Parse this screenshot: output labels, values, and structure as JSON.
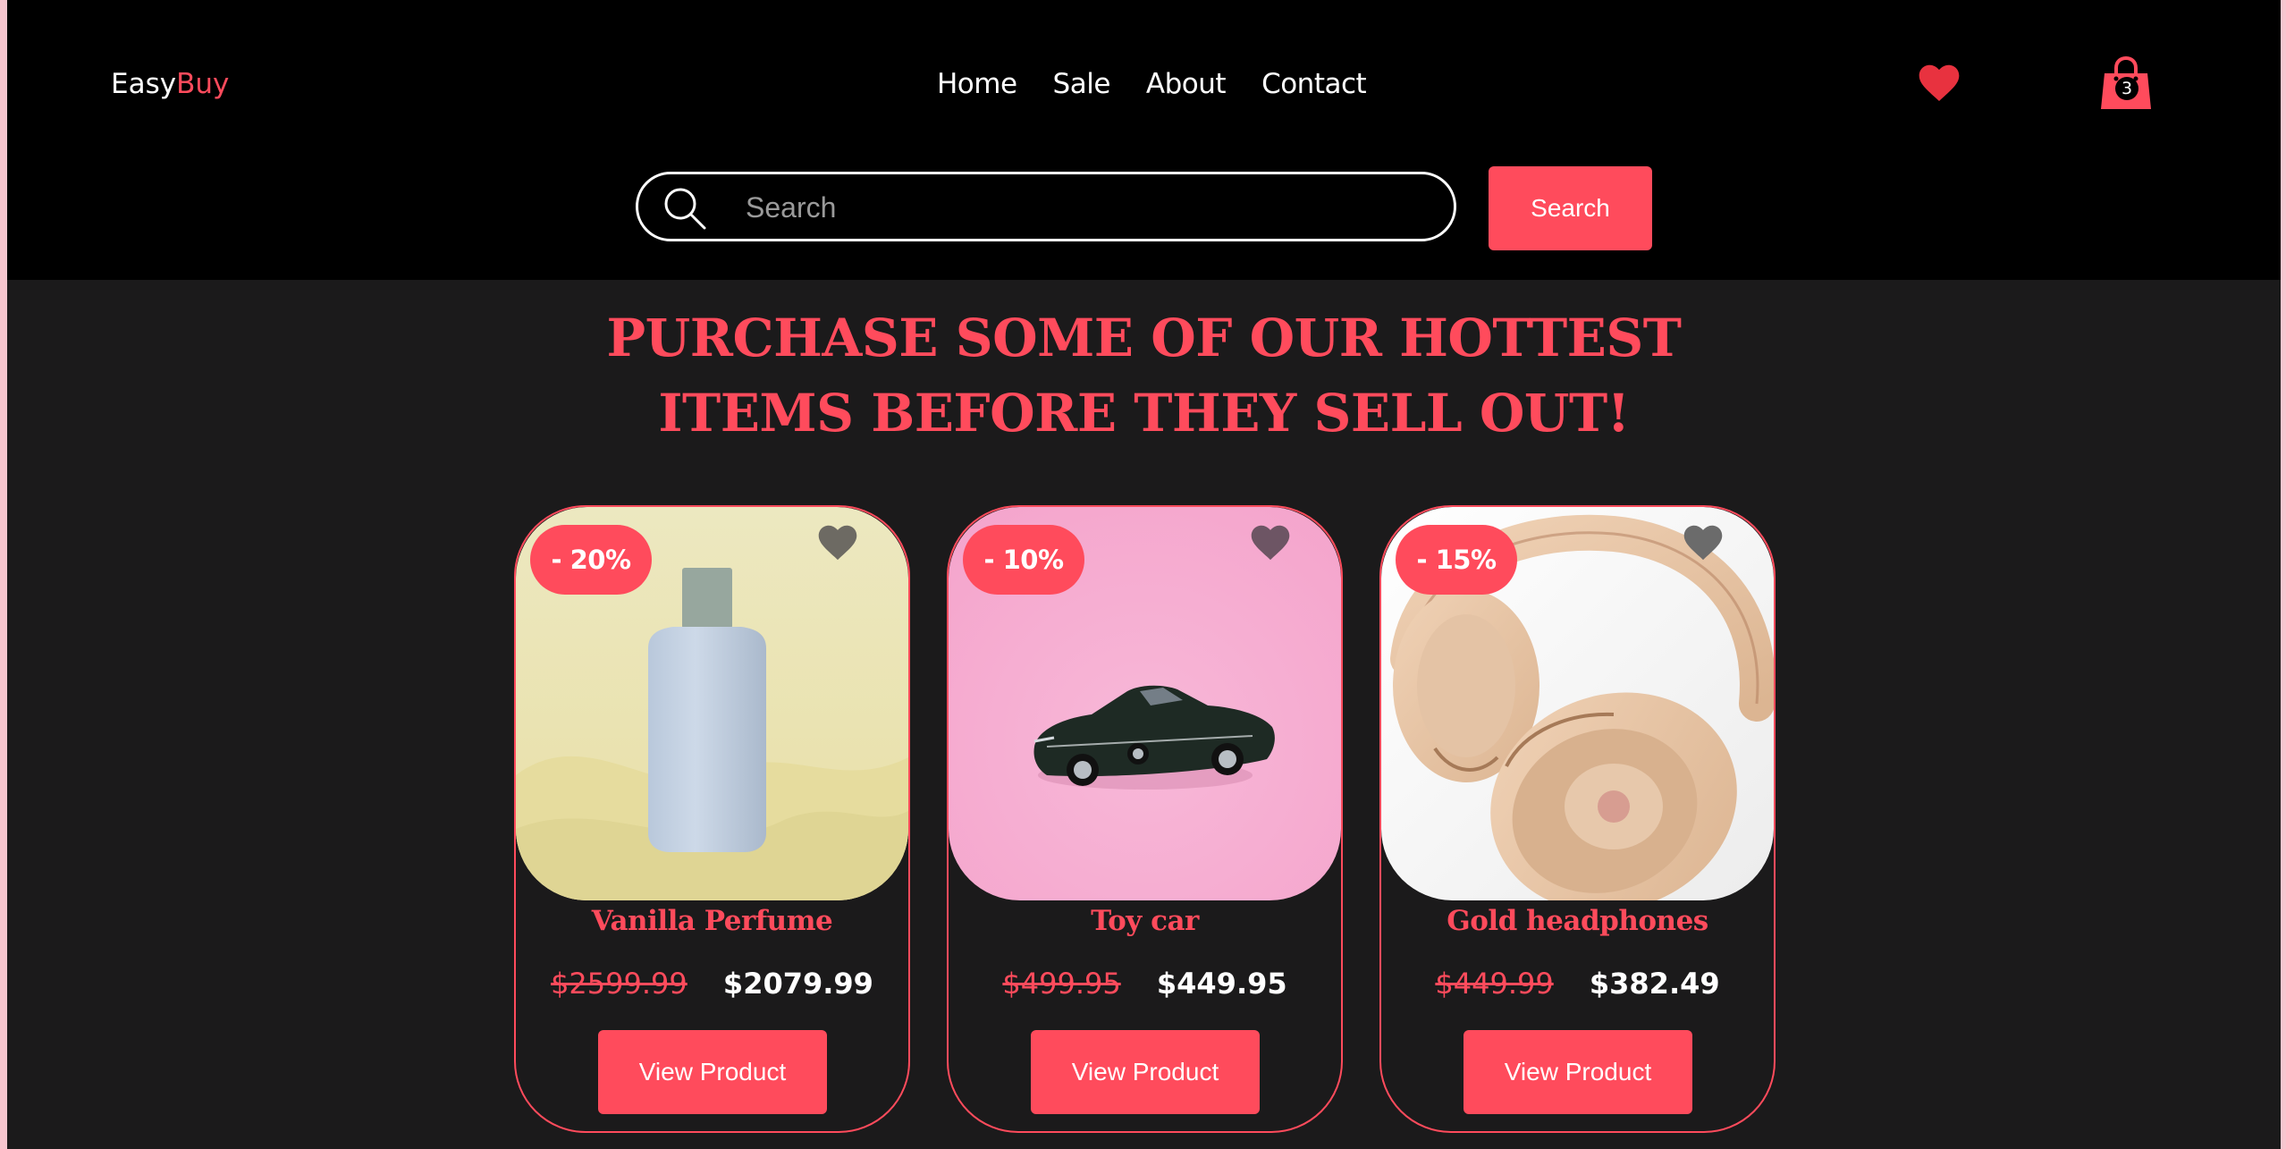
{
  "brand": {
    "name_part1": "Easy",
    "name_part2": "Buy"
  },
  "nav": {
    "items": [
      {
        "label": "Home"
      },
      {
        "label": "Sale"
      },
      {
        "label": "About"
      },
      {
        "label": "Contact"
      }
    ]
  },
  "cart": {
    "count": "3"
  },
  "search": {
    "placeholder": "Search",
    "button_label": "Search"
  },
  "hero": {
    "line1": "PURCHASE SOME OF OUR HOTTEST",
    "line2": "ITEMS BEFORE THEY SELL OUT!"
  },
  "products": [
    {
      "discount": "- 20%",
      "name": "Vanilla Perfume",
      "old_price": "$2599.99",
      "new_price": "$2079.99",
      "button_label": "View Product"
    },
    {
      "discount": "- 10%",
      "name": "Toy car",
      "old_price": "$499.95",
      "new_price": "$449.95",
      "button_label": "View Product"
    },
    {
      "discount": "- 15%",
      "name": "Gold headphones",
      "old_price": "$449.99",
      "new_price": "$382.49",
      "button_label": "View Product"
    }
  ],
  "colors": {
    "accent": "#ff4b5c",
    "header_bg": "#000000",
    "page_bg": "#1b1a1b",
    "text": "#ffffff"
  },
  "icons": [
    "heart-icon",
    "shopping-bag-icon",
    "search-icon"
  ]
}
